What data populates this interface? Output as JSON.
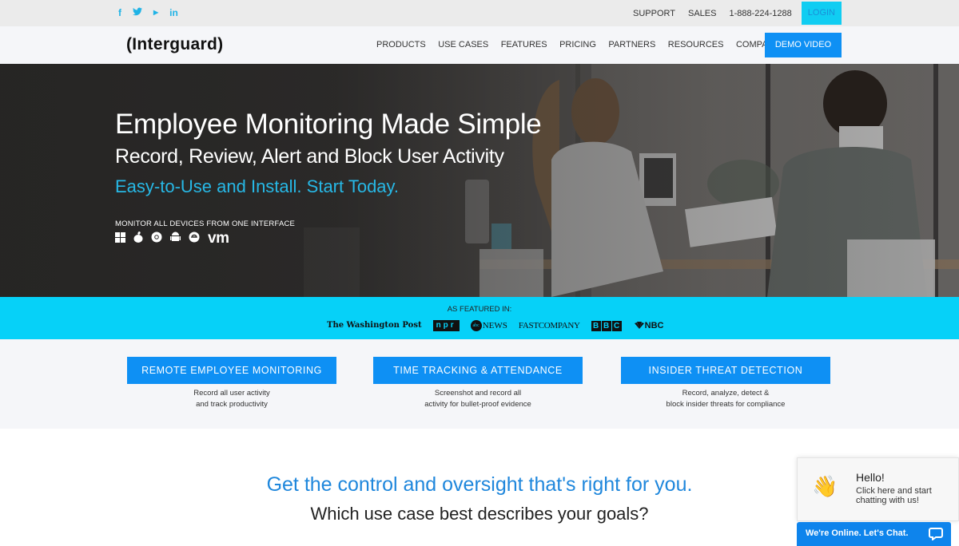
{
  "topbar": {
    "social": [
      {
        "icon": "facebook-icon",
        "glyph": "f"
      },
      {
        "icon": "twitter-icon",
        "glyph": "🐦"
      },
      {
        "icon": "youtube-icon",
        "glyph": "▶"
      },
      {
        "icon": "linkedin-icon",
        "glyph": "in"
      }
    ],
    "links": [
      "SUPPORT",
      "SALES",
      "1-888-224-1288"
    ],
    "login_label": "LOGIN"
  },
  "nav": {
    "logo": "(Interguard)",
    "items": [
      "PRODUCTS",
      "USE CASES",
      "FEATURES",
      "PRICING",
      "PARTNERS",
      "RESOURCES",
      "COMPANY"
    ],
    "demo_label": "DEMO VIDEO"
  },
  "hero": {
    "title": "Employee Monitoring Made Simple",
    "subtitle": "Record, Review, Alert and Block User Activity",
    "tagline": "Easy-to-Use and Install. Start Today.",
    "devices_label": "MONITOR ALL DEVICES FROM ONE INTERFACE",
    "devices": [
      {
        "name": "windows-icon",
        "glyph": "⊞"
      },
      {
        "name": "apple-icon",
        "glyph": ""
      },
      {
        "name": "chrome-icon",
        "glyph": "◎"
      },
      {
        "name": "android-icon",
        "glyph": "🤖"
      },
      {
        "name": "edge-icon",
        "glyph": "◉"
      },
      {
        "name": "vmware-icon",
        "glyph": "vm"
      }
    ]
  },
  "featured": {
    "label": "AS FEATURED IN:",
    "outlets": [
      "The Washington Post",
      "npr",
      "NEWS",
      "FASTCOMPANY",
      "BBC",
      "NBC"
    ],
    "abc_mark": "abc"
  },
  "cases": [
    {
      "label": "REMOTE EMPLOYEE MONITORING",
      "desc1": "Record all user activity",
      "desc2": "and track productivity"
    },
    {
      "label": "TIME TRACKING & ATTENDANCE",
      "desc1": "Screenshot and record all",
      "desc2": "activity for bullet-proof evidence"
    },
    {
      "label": "INSIDER THREAT DETECTION",
      "desc1": "Record, analyze, detect &",
      "desc2": "block insider threats for compliance"
    }
  ],
  "bottom": {
    "headline": "Get the control and oversight that's right for you.",
    "question": "Which use case best describes your goals?"
  },
  "chat": {
    "greeting": "Hello!",
    "message": "Click here and start chatting with us!",
    "bar_label": "We're Online. Let's Chat.",
    "wave_glyph": "👋"
  },
  "colors": {
    "accent_blue": "#0e90f4",
    "cyan_band": "#06d1f8",
    "tagline_cyan": "#27b8e6",
    "headline_blue": "#1f87dc"
  }
}
